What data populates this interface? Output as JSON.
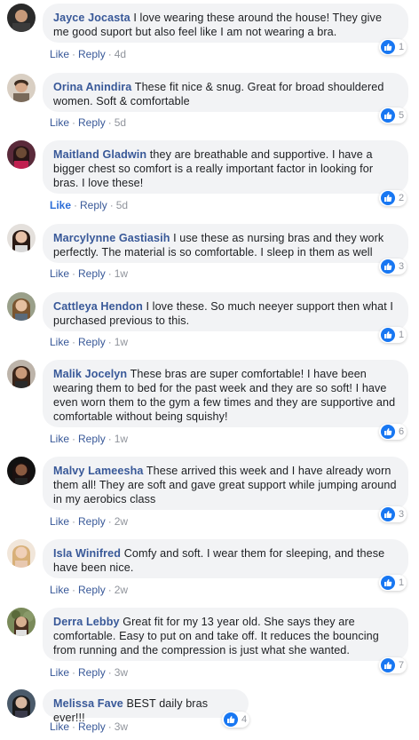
{
  "actions": {
    "like": "Like",
    "reply": "Reply",
    "dot": "·"
  },
  "colors": {
    "author": "#385898",
    "bubble": "#f2f3f5",
    "like_badge": "#1877f2",
    "meta": "#90949c"
  },
  "comments": [
    {
      "author": "Jayce Jocasta",
      "text": "I love wearing these around the house! They give me good suport but also feel like I am not wearing a bra.",
      "reactions": "1",
      "time": "4d",
      "like_active": false
    },
    {
      "author": "Orina Anindira",
      "text": "These fit nice & snug. Great for broad shouldered women. Soft & comfortable",
      "reactions": "5",
      "time": "5d",
      "like_active": false
    },
    {
      "author": "Maitland Gladwin",
      "text": "they are breathable and supportive. I have a bigger chest so comfort is a really important factor in looking for bras. I love these!",
      "reactions": "2",
      "time": "5d",
      "like_active": true
    },
    {
      "author": "Marcylynne Gastiasih",
      "text": "I use these as nursing bras and they work perfectly. The material is so comfortable. I sleep in them as well",
      "reactions": "3",
      "time": "1w",
      "like_active": false
    },
    {
      "author": "Cattleya Hendon",
      "text": "I love these. So much neeyer support then what I purchased previous to this.",
      "reactions": "1",
      "time": "1w",
      "like_active": false
    },
    {
      "author": "Malik Jocelyn",
      "text": "These bras are super comfortable! I have been wearing them to bed for the past week and they are so soft! I have even worn them to the gym a few times and they are supportive and comfortable without being squishy!",
      "reactions": "6",
      "time": "1w",
      "like_active": false
    },
    {
      "author": "Malvy Lameesha",
      "text": "These arrived this week and I have already worn them all! They are soft and gave great support while jumping around in my aerobics class",
      "reactions": "3",
      "time": "2w",
      "like_active": false
    },
    {
      "author": "Isla Winifred",
      "text": "Comfy and soft. I wear them for sleeping, and these have been nice.",
      "reactions": "1",
      "time": "2w",
      "like_active": false
    },
    {
      "author": "Derra Lebby",
      "text": "Great fit for my 13 year old. She says they are comfortable. Easy to put on and take off. It reduces the bouncing from running and the compression is just what she wanted.",
      "reactions": "7",
      "time": "3w",
      "like_active": false
    },
    {
      "author": "Melissa Fave",
      "text": "BEST daily bras ever!!!",
      "reactions": "4",
      "time": "3w",
      "like_active": false
    }
  ]
}
